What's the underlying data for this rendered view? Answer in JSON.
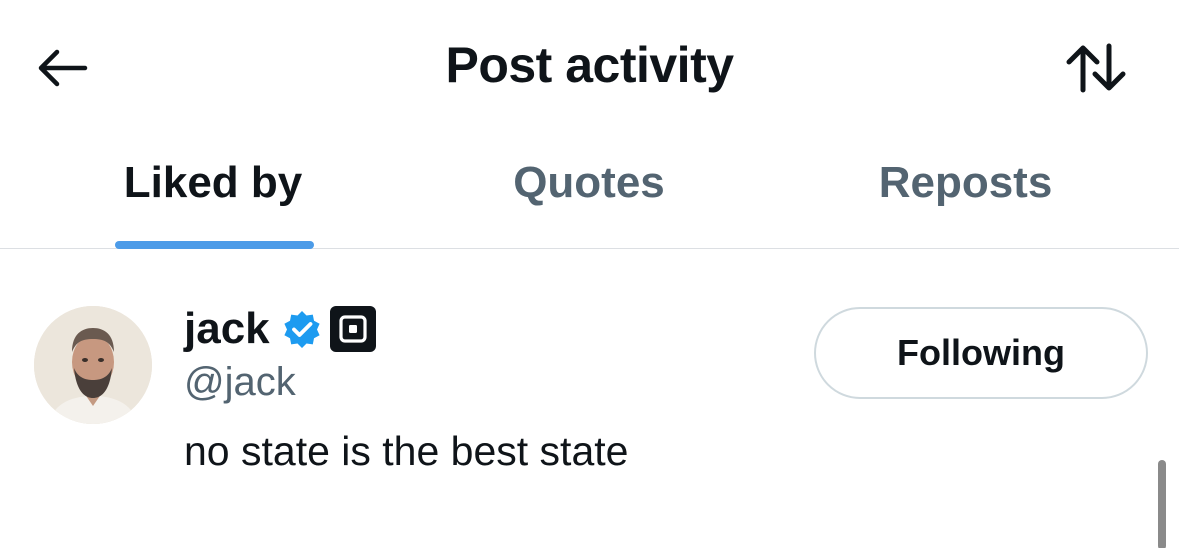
{
  "header": {
    "title": "Post activity",
    "back_icon": "arrow-left-icon",
    "sort_icon": "sort-arrows-icon"
  },
  "tabs": [
    {
      "label": "Liked by",
      "active": true
    },
    {
      "label": "Quotes",
      "active": false
    },
    {
      "label": "Reposts",
      "active": false
    }
  ],
  "user": {
    "display_name": "jack",
    "handle": "@jack",
    "bio": "no state is the best state",
    "follow_button_label": "Following",
    "verified": true,
    "verified_icon": "verified-badge-icon",
    "affiliate_icon": "square-logo-icon"
  },
  "colors": {
    "accent": "#4c9be8",
    "verified": "#1d9bf0",
    "text_primary": "#0f1419",
    "text_secondary": "#536471",
    "border": "#cfd9de"
  }
}
